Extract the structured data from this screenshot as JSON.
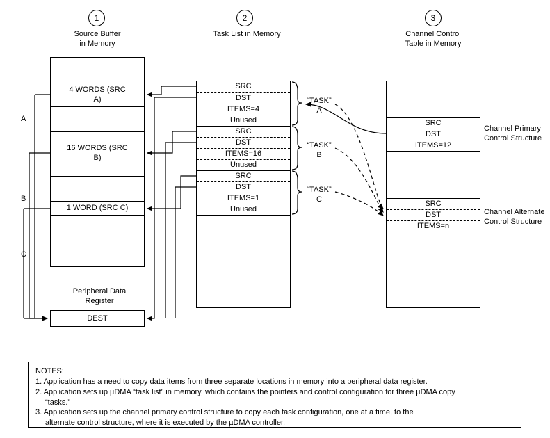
{
  "steps": {
    "s1": {
      "num": "1",
      "title_l1": "Source Buffer",
      "title_l2": "in Memory"
    },
    "s2": {
      "num": "2",
      "title_l1": "Task List in Memory"
    },
    "s3": {
      "num": "3",
      "title_l1": "Channel Control",
      "title_l2": "Table in Memory"
    }
  },
  "source_buffer": {
    "row_a_l1": "4 WORDS (SRC",
    "row_a_l2": "A)",
    "row_b_l1": "16 WORDS (SRC",
    "row_b_l2": "B)",
    "row_c": "1 WORD (SRC C)",
    "lbl_a": "A",
    "lbl_b": "B",
    "lbl_c": "C"
  },
  "peripheral": {
    "title_l1": "Peripheral Data",
    "title_l2": "Register",
    "dest": "DEST"
  },
  "tasklist": {
    "a": {
      "src": "SRC",
      "dst": "DST",
      "items": "ITEMS=4",
      "unused": "Unused"
    },
    "b": {
      "src": "SRC",
      "dst": "DST",
      "items": "ITEMS=16",
      "unused": "Unused"
    },
    "c": {
      "src": "SRC",
      "dst": "DST",
      "items": "ITEMS=1",
      "unused": "Unused"
    }
  },
  "task_labels": {
    "a_l1": "“TASK”",
    "a_l2": "A",
    "b_l1": "“TASK”",
    "b_l2": "B",
    "c_l1": "“TASK”",
    "c_l2": "C"
  },
  "channel_table": {
    "primary": {
      "src": "SRC",
      "dst": "DST",
      "items": "ITEMS=12",
      "label_l1": "Channel Primary",
      "label_l2": "Control Structure"
    },
    "alternate": {
      "src": "SRC",
      "dst": "DST",
      "items": "ITEMS=n",
      "label_l1": "Channel Alternate",
      "label_l2": "Control Structure"
    }
  },
  "notes": {
    "heading": "NOTES:",
    "n1": "1.  Application has a need to copy data items from three separate locations in memory into a peripheral data register.",
    "n2": "2.  Application sets up µDMA “task list” in memory, which contains the pointers and control configuration for three  µDMA copy",
    "n2b": "“tasks.”",
    "n3": "3.  Application sets up the channel primary control structure to copy each task configuration, one at a time, to the",
    "n3b": "alternate control structure, where it is executed by the µDMA controller."
  }
}
